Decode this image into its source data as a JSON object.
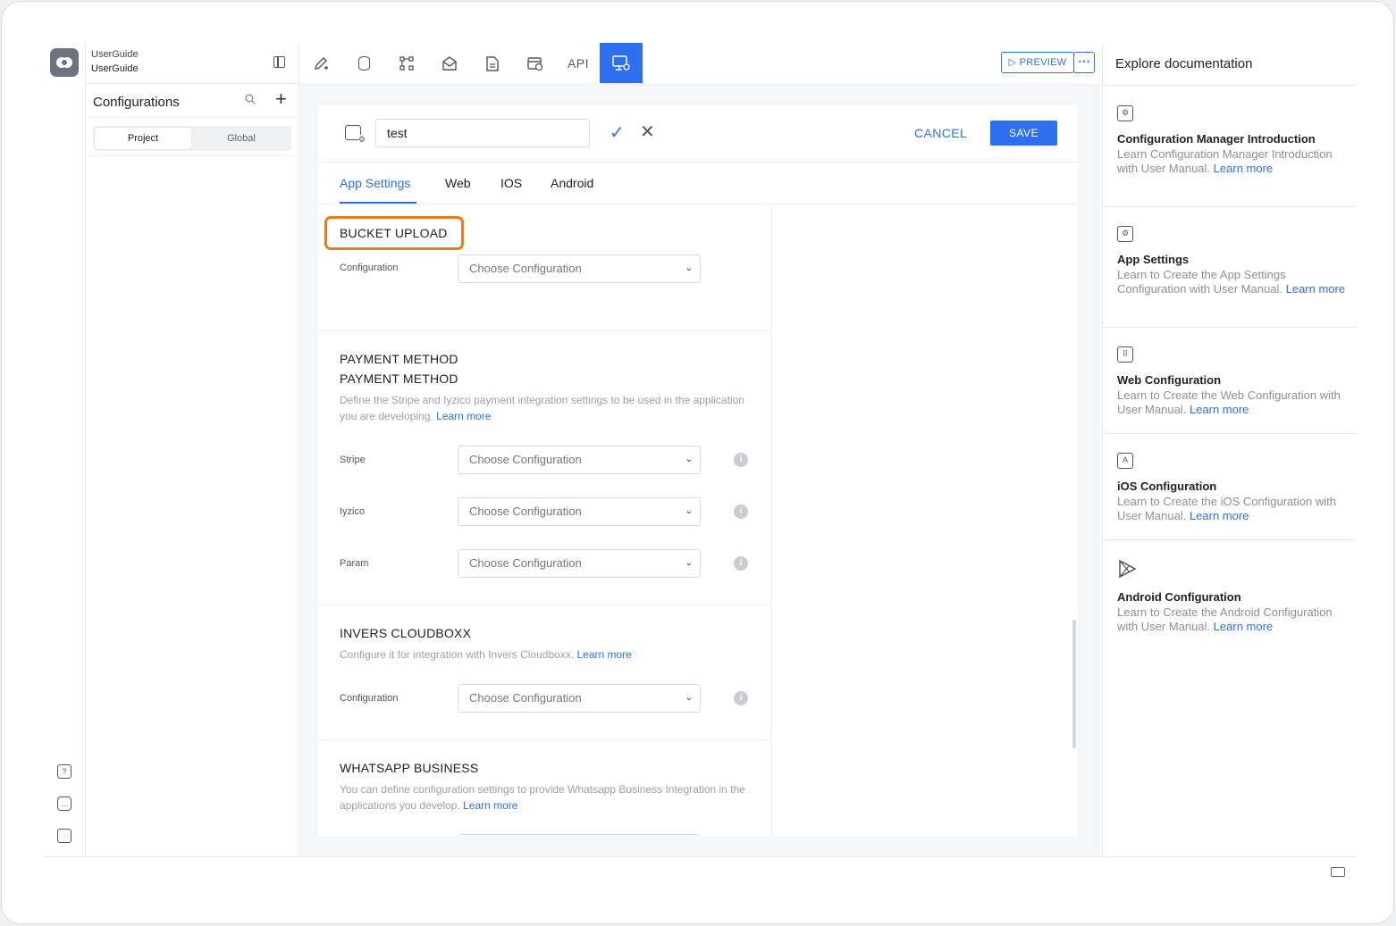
{
  "project": {
    "line1": "UserGuide",
    "line2": "UserGuide"
  },
  "sidebar": {
    "title": "Configurations",
    "segments": {
      "project": "Project",
      "global": "Global"
    }
  },
  "toolbar": {
    "api_label": "API",
    "preview_label": "PREVIEW",
    "more_label": "⋯"
  },
  "editor": {
    "name_value": "test",
    "cancel_label": "CANCEL",
    "save_label": "SAVE",
    "tabs": [
      "App Settings",
      "Web",
      "IOS",
      "Android"
    ],
    "active_tab": "App Settings"
  },
  "sections": {
    "bucket": {
      "title": "BUCKET UPLOAD",
      "rows": [
        {
          "label": "Configuration",
          "placeholder": "Choose Configuration"
        }
      ]
    },
    "payment": {
      "title": "PAYMENT METHOD",
      "subtitle": "PAYMENT METHOD",
      "desc": "Define the Stripe and Iyzico payment integration settings to be used in the application you are developing.",
      "learn": "Learn more",
      "rows": [
        {
          "label": "Stripe",
          "placeholder": "Choose Configuration"
        },
        {
          "label": "Iyzico",
          "placeholder": "Choose Configuration"
        },
        {
          "label": "Param",
          "placeholder": "Choose Configuration"
        }
      ]
    },
    "invers": {
      "title": "INVERS CLOUDBOXX",
      "desc": "Configure it for integration with Invers Cloudboxx.",
      "learn": "Learn more",
      "rows": [
        {
          "label": "Configuration",
          "placeholder": "Choose Configuration"
        }
      ]
    },
    "whatsapp": {
      "title": "WHATSAPP BUSINESS",
      "desc": "You can define configuration settings to provide Whatsapp Business Integration in the applications you develop.",
      "learn": "Learn more"
    }
  },
  "docs": {
    "title": "Explore documentation",
    "items": [
      {
        "icon": "window-gear-icon",
        "title": "Configuration Manager Introduction",
        "desc": "Learn Configuration Manager Introduction with User Manual.",
        "learn": "Learn more"
      },
      {
        "icon": "window-gear-icon",
        "title": "App Settings",
        "desc": "Learn to Create the App Settings Configuration with User Manual.",
        "learn": "Learn more"
      },
      {
        "icon": "browser-grid-icon",
        "title": "Web Configuration",
        "desc": "Learn to Create the Web Configuration with User Manual.",
        "learn": "Learn more"
      },
      {
        "icon": "app-store-icon",
        "title": "iOS Configuration",
        "desc": "Learn to Create the iOS Configuration with User Manual.",
        "learn": "Learn more"
      },
      {
        "icon": "play-store-icon",
        "title": "Android Configuration",
        "desc": "Learn to Create the Android Configuration with User Manual.",
        "learn": "Learn more"
      }
    ]
  },
  "colors": {
    "accent": "#2e6ff0",
    "highlight": "#ee7a13"
  }
}
